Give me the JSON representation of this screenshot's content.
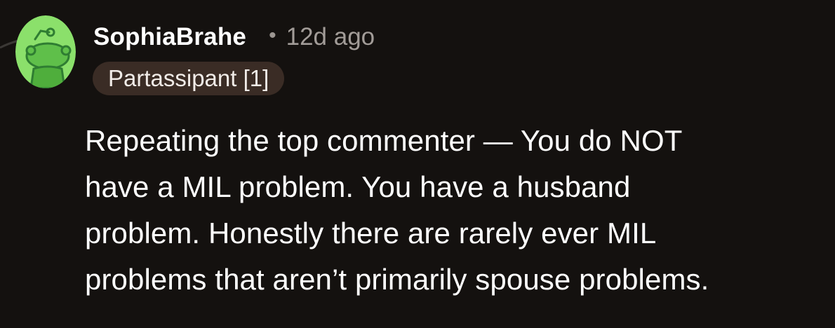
{
  "comment": {
    "author": "SophiaBrahe",
    "separator": "•",
    "timestamp": "12d ago",
    "flair": "Partassipant [1]",
    "body_lines": [
      "Repeating the top commenter — You do NOT",
      "have a MIL problem. You have a husband",
      "problem. Honestly there are rarely ever MIL",
      "problems that aren’t primarily spouse problems."
    ]
  },
  "icons": {
    "avatar": "snoo-avatar-icon"
  },
  "colors": {
    "background": "#14110f",
    "avatar_green": "#8be06b",
    "flair_background": "#3a2c25",
    "muted_text": "#a29c98"
  }
}
